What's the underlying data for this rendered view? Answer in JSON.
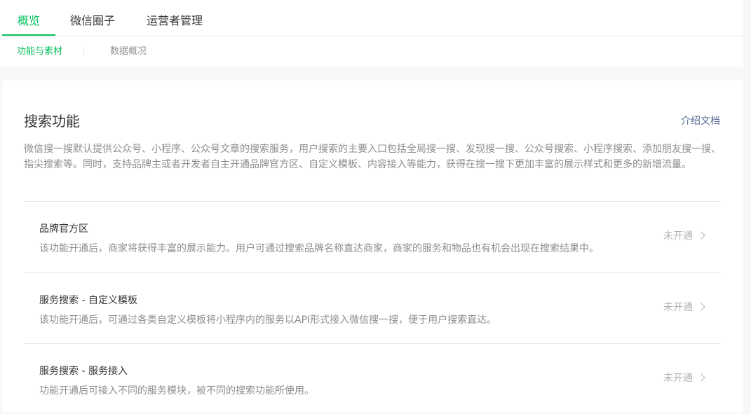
{
  "top_tabs": [
    {
      "label": "概览",
      "active": true
    },
    {
      "label": "微信圈子",
      "active": false
    },
    {
      "label": "运营者管理",
      "active": false
    }
  ],
  "sub_tabs": [
    {
      "label": "功能与素材",
      "active": true
    },
    {
      "label": "数据概况",
      "active": false
    }
  ],
  "section": {
    "title": "搜索功能",
    "doc_link": "介绍文档",
    "description": "微信搜一搜默认提供公众号、小程序、公众号文章的搜索服务，用户搜索的主要入口包括全局搜一搜、发现搜一搜、公众号搜索、小程序搜索、添加朋友搜一搜、指尖搜索等。同时，支持品牌主或者开发者自主开通品牌官方区、自定义模板、内容接入等能力，获得在搜一搜下更加丰富的展示样式和更多的新增流量。"
  },
  "items": [
    {
      "title": "品牌官方区",
      "desc": "该功能开通后，商家将获得丰富的展示能力。用户可通过搜索品牌名称直达商家，商家的服务和物品也有机会出现在搜索结果中。",
      "status": "未开通"
    },
    {
      "title": "服务搜索 - 自定义模板",
      "desc": "该功能开通后，可通过各类自定义模板将小程序内的服务以API形式接入微信搜一搜，便于用户搜索直达。",
      "status": "未开通"
    },
    {
      "title": "服务搜索 - 服务接入",
      "desc": "功能开通后可接入不同的服务模块，被不同的搜索功能所使用。",
      "status": "未开通"
    }
  ],
  "colors": {
    "accent": "#07c160",
    "link": "#576b95"
  }
}
